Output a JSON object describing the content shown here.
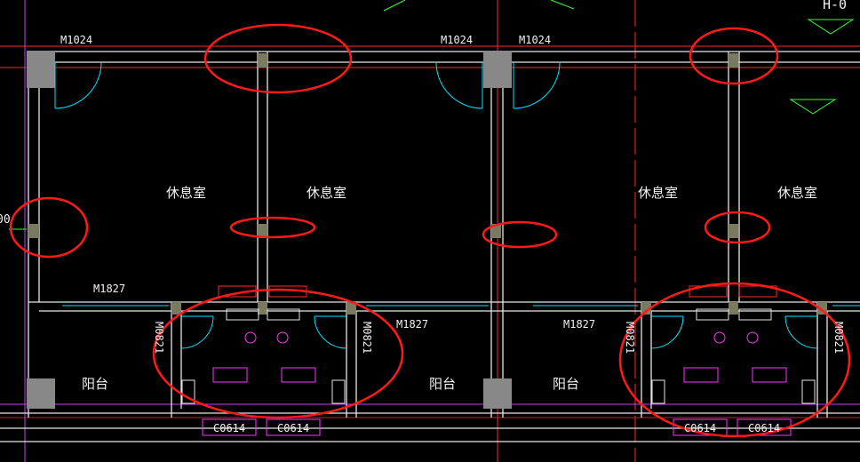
{
  "drawing": {
    "rooms": {
      "rest_room_1": "休息室",
      "rest_room_2": "休息室",
      "rest_room_3": "休息室",
      "rest_room_4": "休息室",
      "balcony_1": "阳台",
      "balcony_2": "阳台",
      "balcony_3": "阳台"
    },
    "doors": {
      "top_1": "M1024",
      "top_2": "M1024",
      "top_3": "M1024",
      "mid_1": "M1827",
      "mid_2": "M1827",
      "mid_3": "M1827",
      "side_1": "M0821",
      "side_2": "M0821",
      "side_3": "M0821",
      "side_4": "M0821"
    },
    "windows": {
      "w1": "C0614",
      "w2": "C0614",
      "w3": "C0614",
      "w4": "C0614"
    },
    "elevation_label": "H-0",
    "side_marker": "00"
  },
  "colors": {
    "background": "#000000",
    "wall": "#e6e6e6",
    "axis": "#ff2a2a",
    "door": "#00e5ff",
    "fixture": "#ff33ff",
    "highlight": "#ff1a1a",
    "elevation": "#33ff33",
    "column": "#888888"
  }
}
